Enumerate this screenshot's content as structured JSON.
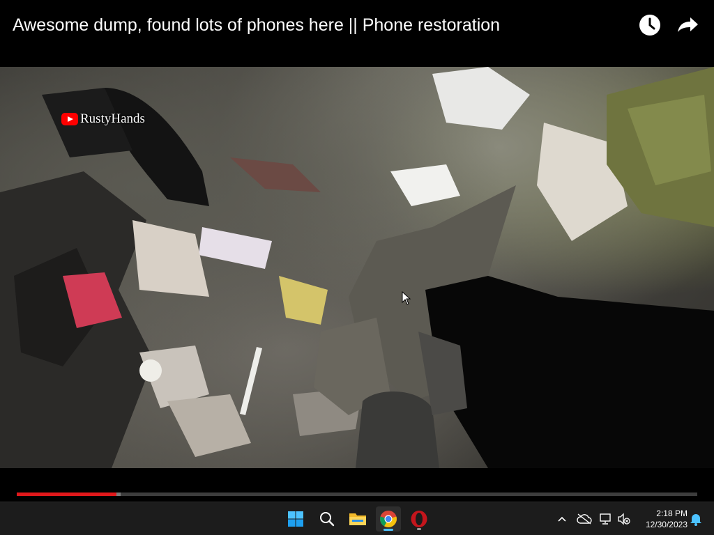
{
  "video": {
    "title": "Awesome dump, found lots of phones here || Phone restoration",
    "channel_watermark": "RustyHands",
    "progress_fraction": 0.147,
    "buffered_fraction": 0.006
  },
  "actions": {
    "watch_later_icon": "clock-icon",
    "share_icon": "share-arrow-icon"
  },
  "taskbar": {
    "apps": [
      {
        "name": "start",
        "icon": "windows-logo-icon"
      },
      {
        "name": "search",
        "icon": "search-icon"
      },
      {
        "name": "file-explorer",
        "icon": "folder-icon"
      },
      {
        "name": "chrome",
        "icon": "chrome-icon",
        "active": true
      },
      {
        "name": "opera",
        "icon": "opera-icon"
      }
    ],
    "tray": {
      "time": "2:18 PM",
      "date": "12/30/2023"
    }
  },
  "colors": {
    "progress": "#e0181b",
    "active_indicator": "#4cc2ff",
    "taskbar_bg": "#1c1c1c"
  }
}
